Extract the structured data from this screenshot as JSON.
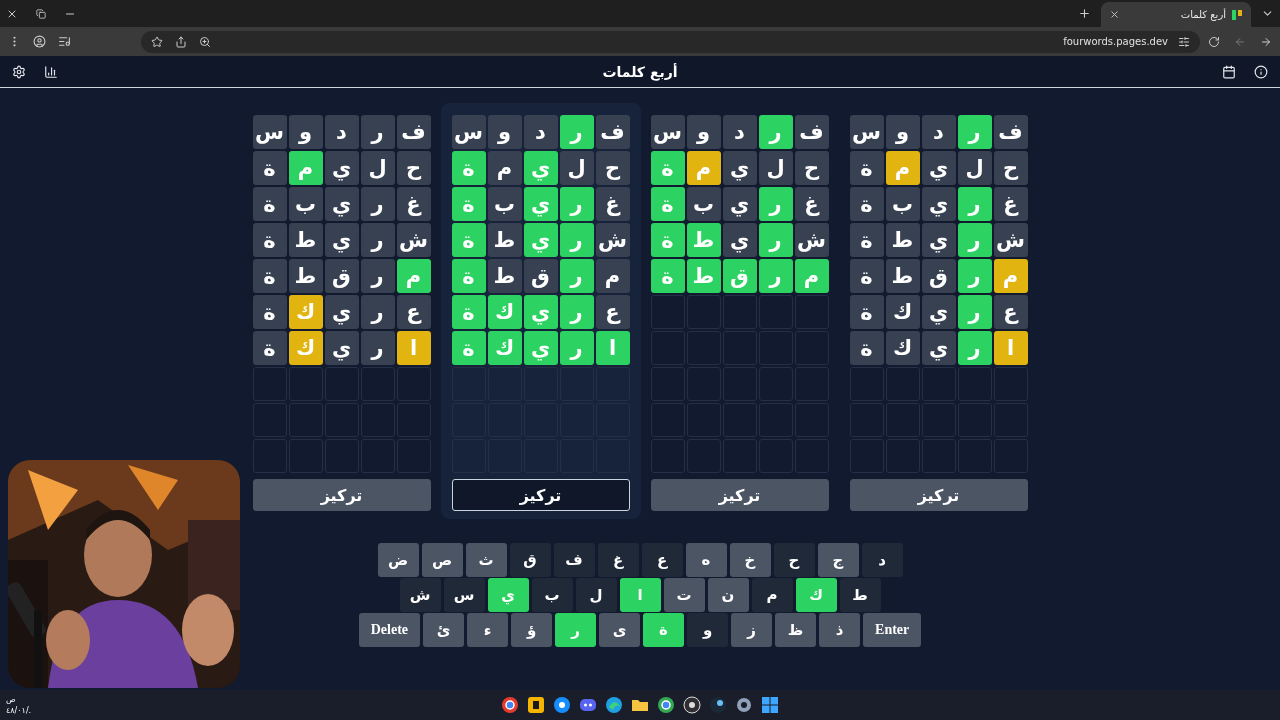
{
  "browser": {
    "tab": {
      "title": "أربع كلمات"
    },
    "address": "fourwords.pages.dev"
  },
  "header": {
    "title": "أربع كلمات"
  },
  "boards": [
    {
      "selected": false,
      "focus_button": "تركيز",
      "rows": [
        {
          "cells": [
            {
              "letter": "ف",
              "color": "#374151"
            },
            {
              "letter": "ر",
              "color": "#2dd362"
            },
            {
              "letter": "د",
              "color": "#374151"
            },
            {
              "letter": "و",
              "color": "#374151"
            },
            {
              "letter": "س",
              "color": "#374151"
            }
          ]
        },
        {
          "cells": [
            {
              "letter": "ح",
              "color": "#374151"
            },
            {
              "letter": "ل",
              "color": "#374151"
            },
            {
              "letter": "ي",
              "color": "#374151"
            },
            {
              "letter": "م",
              "color": "#e2b40f"
            },
            {
              "letter": "ة",
              "color": "#374151"
            }
          ]
        },
        {
          "cells": [
            {
              "letter": "غ",
              "color": "#374151"
            },
            {
              "letter": "ر",
              "color": "#2dd362"
            },
            {
              "letter": "ي",
              "color": "#374151"
            },
            {
              "letter": "ب",
              "color": "#374151"
            },
            {
              "letter": "ة",
              "color": "#374151"
            }
          ]
        },
        {
          "cells": [
            {
              "letter": "ش",
              "color": "#374151"
            },
            {
              "letter": "ر",
              "color": "#2dd362"
            },
            {
              "letter": "ي",
              "color": "#374151"
            },
            {
              "letter": "ط",
              "color": "#374151"
            },
            {
              "letter": "ة",
              "color": "#374151"
            }
          ]
        },
        {
          "cells": [
            {
              "letter": "م",
              "color": "#e2b40f"
            },
            {
              "letter": "ر",
              "color": "#2dd362"
            },
            {
              "letter": "ق",
              "color": "#374151"
            },
            {
              "letter": "ط",
              "color": "#374151"
            },
            {
              "letter": "ة",
              "color": "#374151"
            }
          ]
        },
        {
          "cells": [
            {
              "letter": "ع",
              "color": "#374151"
            },
            {
              "letter": "ر",
              "color": "#2dd362"
            },
            {
              "letter": "ي",
              "color": "#374151"
            },
            {
              "letter": "ك",
              "color": "#374151"
            },
            {
              "letter": "ة",
              "color": "#374151"
            }
          ]
        },
        {
          "cells": [
            {
              "letter": "ا",
              "color": "#e2b40f"
            },
            {
              "letter": "ر",
              "color": "#2dd362"
            },
            {
              "letter": "ي",
              "color": "#374151"
            },
            {
              "letter": "ك",
              "color": "#374151"
            },
            {
              "letter": "ة",
              "color": "#374151"
            }
          ]
        }
      ]
    },
    {
      "selected": false,
      "focus_button": "تركيز",
      "rows": [
        {
          "cells": [
            {
              "letter": "ف",
              "color": "#374151"
            },
            {
              "letter": "ر",
              "color": "#2dd362"
            },
            {
              "letter": "د",
              "color": "#374151"
            },
            {
              "letter": "و",
              "color": "#374151"
            },
            {
              "letter": "س",
              "color": "#374151"
            }
          ]
        },
        {
          "cells": [
            {
              "letter": "ح",
              "color": "#374151"
            },
            {
              "letter": "ل",
              "color": "#374151"
            },
            {
              "letter": "ي",
              "color": "#374151"
            },
            {
              "letter": "م",
              "color": "#e2b40f"
            },
            {
              "letter": "ة",
              "color": "#2dd362"
            }
          ]
        },
        {
          "cells": [
            {
              "letter": "غ",
              "color": "#374151"
            },
            {
              "letter": "ر",
              "color": "#2dd362"
            },
            {
              "letter": "ي",
              "color": "#374151"
            },
            {
              "letter": "ب",
              "color": "#374151"
            },
            {
              "letter": "ة",
              "color": "#2dd362"
            }
          ]
        },
        {
          "cells": [
            {
              "letter": "ش",
              "color": "#374151"
            },
            {
              "letter": "ر",
              "color": "#2dd362"
            },
            {
              "letter": "ي",
              "color": "#374151"
            },
            {
              "letter": "ط",
              "color": "#2dd362"
            },
            {
              "letter": "ة",
              "color": "#2dd362"
            }
          ]
        },
        {
          "cells": [
            {
              "letter": "م",
              "color": "#2dd362"
            },
            {
              "letter": "ر",
              "color": "#2dd362"
            },
            {
              "letter": "ق",
              "color": "#2dd362"
            },
            {
              "letter": "ط",
              "color": "#2dd362"
            },
            {
              "letter": "ة",
              "color": "#2dd362"
            }
          ]
        }
      ]
    },
    {
      "selected": true,
      "focus_button": "تركيز",
      "rows": [
        {
          "cells": [
            {
              "letter": "ف",
              "color": "#374151"
            },
            {
              "letter": "ر",
              "color": "#2dd362"
            },
            {
              "letter": "د",
              "color": "#374151"
            },
            {
              "letter": "و",
              "color": "#374151"
            },
            {
              "letter": "س",
              "color": "#374151"
            }
          ]
        },
        {
          "cells": [
            {
              "letter": "ح",
              "color": "#374151"
            },
            {
              "letter": "ل",
              "color": "#374151"
            },
            {
              "letter": "ي",
              "color": "#2dd362"
            },
            {
              "letter": "م",
              "color": "#374151"
            },
            {
              "letter": "ة",
              "color": "#2dd362"
            }
          ]
        },
        {
          "cells": [
            {
              "letter": "غ",
              "color": "#374151"
            },
            {
              "letter": "ر",
              "color": "#2dd362"
            },
            {
              "letter": "ي",
              "color": "#2dd362"
            },
            {
              "letter": "ب",
              "color": "#374151"
            },
            {
              "letter": "ة",
              "color": "#2dd362"
            }
          ]
        },
        {
          "cells": [
            {
              "letter": "ش",
              "color": "#374151"
            },
            {
              "letter": "ر",
              "color": "#2dd362"
            },
            {
              "letter": "ي",
              "color": "#2dd362"
            },
            {
              "letter": "ط",
              "color": "#374151"
            },
            {
              "letter": "ة",
              "color": "#2dd362"
            }
          ]
        },
        {
          "cells": [
            {
              "letter": "م",
              "color": "#374151"
            },
            {
              "letter": "ر",
              "color": "#2dd362"
            },
            {
              "letter": "ق",
              "color": "#374151"
            },
            {
              "letter": "ط",
              "color": "#374151"
            },
            {
              "letter": "ة",
              "color": "#2dd362"
            }
          ]
        },
        {
          "cells": [
            {
              "letter": "ع",
              "color": "#374151"
            },
            {
              "letter": "ر",
              "color": "#2dd362"
            },
            {
              "letter": "ي",
              "color": "#2dd362"
            },
            {
              "letter": "ك",
              "color": "#2dd362"
            },
            {
              "letter": "ة",
              "color": "#2dd362"
            }
          ]
        },
        {
          "cells": [
            {
              "letter": "ا",
              "color": "#2dd362"
            },
            {
              "letter": "ر",
              "color": "#2dd362"
            },
            {
              "letter": "ي",
              "color": "#2dd362"
            },
            {
              "letter": "ك",
              "color": "#2dd362"
            },
            {
              "letter": "ة",
              "color": "#2dd362"
            }
          ]
        }
      ]
    },
    {
      "selected": false,
      "focus_button": "تركيز",
      "rows": [
        {
          "cells": [
            {
              "letter": "ف",
              "color": "#374151"
            },
            {
              "letter": "ر",
              "color": "#374151"
            },
            {
              "letter": "د",
              "color": "#374151"
            },
            {
              "letter": "و",
              "color": "#374151"
            },
            {
              "letter": "س",
              "color": "#374151"
            }
          ]
        },
        {
          "cells": [
            {
              "letter": "ح",
              "color": "#374151"
            },
            {
              "letter": "ل",
              "color": "#374151"
            },
            {
              "letter": "ي",
              "color": "#374151"
            },
            {
              "letter": "م",
              "color": "#2dd362"
            },
            {
              "letter": "ة",
              "color": "#374151"
            }
          ]
        },
        {
          "cells": [
            {
              "letter": "غ",
              "color": "#374151"
            },
            {
              "letter": "ر",
              "color": "#374151"
            },
            {
              "letter": "ي",
              "color": "#374151"
            },
            {
              "letter": "ب",
              "color": "#374151"
            },
            {
              "letter": "ة",
              "color": "#374151"
            }
          ]
        },
        {
          "cells": [
            {
              "letter": "ش",
              "color": "#374151"
            },
            {
              "letter": "ر",
              "color": "#374151"
            },
            {
              "letter": "ي",
              "color": "#374151"
            },
            {
              "letter": "ط",
              "color": "#374151"
            },
            {
              "letter": "ة",
              "color": "#374151"
            }
          ]
        },
        {
          "cells": [
            {
              "letter": "م",
              "color": "#2dd362"
            },
            {
              "letter": "ر",
              "color": "#374151"
            },
            {
              "letter": "ق",
              "color": "#374151"
            },
            {
              "letter": "ط",
              "color": "#374151"
            },
            {
              "letter": "ة",
              "color": "#374151"
            }
          ]
        },
        {
          "cells": [
            {
              "letter": "ع",
              "color": "#374151"
            },
            {
              "letter": "ر",
              "color": "#374151"
            },
            {
              "letter": "ي",
              "color": "#374151"
            },
            {
              "letter": "ك",
              "color": "#e2b40f"
            },
            {
              "letter": "ة",
              "color": "#374151"
            }
          ]
        },
        {
          "cells": [
            {
              "letter": "ا",
              "color": "#e2b40f"
            },
            {
              "letter": "ر",
              "color": "#374151"
            },
            {
              "letter": "ي",
              "color": "#374151"
            },
            {
              "letter": "ك",
              "color": "#e2b40f"
            },
            {
              "letter": "ة",
              "color": "#374151"
            }
          ]
        }
      ]
    }
  ],
  "keyboard": {
    "rows": [
      {
        "keys": [
          {
            "label": "د",
            "color": "#1f2937"
          },
          {
            "label": "ج",
            "color": "#4b5563"
          },
          {
            "label": "ح",
            "color": "#1f2937"
          },
          {
            "label": "خ",
            "color": "#4b5563"
          },
          {
            "label": "ه",
            "color": "#4b5563"
          },
          {
            "label": "ع",
            "color": "#1f2937"
          },
          {
            "label": "غ",
            "color": "#1f2937"
          },
          {
            "label": "ف",
            "color": "#1f2937"
          },
          {
            "label": "ق",
            "color": "#1f2937"
          },
          {
            "label": "ث",
            "color": "#4b5563"
          },
          {
            "label": "ص",
            "color": "#4b5563"
          },
          {
            "label": "ض",
            "color": "#4b5563"
          }
        ]
      },
      {
        "keys": [
          {
            "label": "ط",
            "color": "#1f2937"
          },
          {
            "label": "ك",
            "color": "#2dd362"
          },
          {
            "label": "م",
            "color": "#1f2937"
          },
          {
            "label": "ن",
            "color": "#4b5563"
          },
          {
            "label": "ت",
            "color": "#4b5563"
          },
          {
            "label": "ا",
            "color": "#2dd362"
          },
          {
            "label": "ل",
            "color": "#1f2937"
          },
          {
            "label": "ب",
            "color": "#1f2937"
          },
          {
            "label": "ي",
            "color": "#2dd362"
          },
          {
            "label": "س",
            "color": "#1f2937"
          },
          {
            "label": "ش",
            "color": "#1f2937"
          }
        ]
      },
      {
        "keys": [
          {
            "label": "Enter",
            "color": "#4b5563"
          },
          {
            "label": "ذ",
            "color": "#4b5563"
          },
          {
            "label": "ظ",
            "color": "#4b5563"
          },
          {
            "label": "ز",
            "color": "#4b5563"
          },
          {
            "label": "و",
            "color": "#1f2937"
          },
          {
            "label": "ة",
            "color": "#2dd362"
          },
          {
            "label": "ى",
            "color": "#4b5563"
          },
          {
            "label": "ر",
            "color": "#2dd362"
          },
          {
            "label": "ؤ",
            "color": "#4b5563"
          },
          {
            "label": "ء",
            "color": "#4b5563"
          },
          {
            "label": "ئ",
            "color": "#4b5563"
          },
          {
            "label": "Delete",
            "color": "#4b5563"
          }
        ]
      }
    ]
  },
  "taskbar": {
    "clock": {
      "time": "ص",
      "date": "٤٨/٠١/."
    }
  }
}
